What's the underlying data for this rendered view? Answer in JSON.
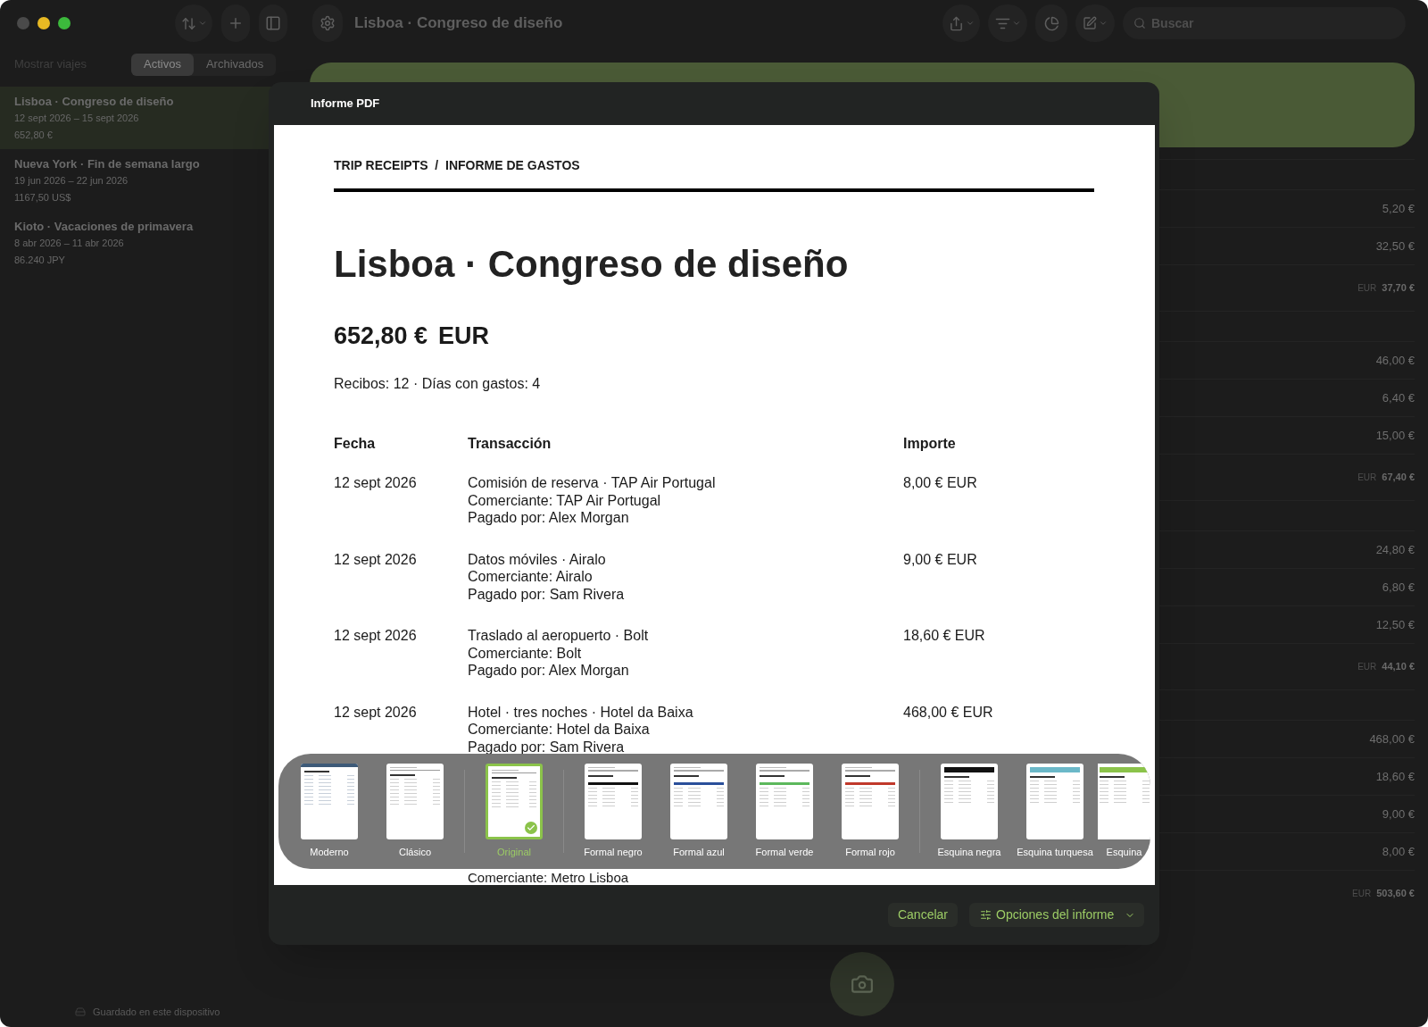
{
  "window": {
    "title": "Lisboa · Congreso de diseño"
  },
  "toolbar": {
    "search": {
      "placeholder": "Buscar"
    }
  },
  "sidebar": {
    "filter_label": "Mostrar viajes",
    "segments": [
      {
        "label": "Activos",
        "selected": true
      },
      {
        "label": "Archivados",
        "selected": false
      }
    ],
    "trips": [
      {
        "title": "Lisboa · Congreso de diseño",
        "dates": "12 sept 2026 – 15 sept 2026",
        "total": "652,80 €",
        "selected": true
      },
      {
        "title": "Nueva York · Fin de semana largo",
        "dates": "19 jun 2026 – 22 jun 2026",
        "total": "1167,50 US$",
        "selected": false
      },
      {
        "title": "Kioto · Vacaciones de primavera",
        "dates": "8 abr 2026 – 11 abr 2026",
        "total": "86.240 JPY",
        "selected": false
      }
    ],
    "status": "Guardado en este dispositivo"
  },
  "expense_groups": [
    {
      "amounts": [
        "5,20 €",
        "32,50 €"
      ],
      "subtotal": {
        "currency": "EUR",
        "amount": "37,70 €"
      }
    },
    {
      "amounts": [
        "46,00 €",
        "6,40 €",
        "15,00 €"
      ],
      "subtotal": {
        "currency": "EUR",
        "amount": "67,40 €"
      }
    },
    {
      "amounts": [
        "24,80 €",
        "6,80 €",
        "12,50 €"
      ],
      "subtotal": {
        "currency": "EUR",
        "amount": "44,10 €"
      }
    },
    {
      "amounts": [
        "468,00 €",
        "18,60 €",
        "9,00 €",
        "8,00 €"
      ],
      "subtotal": {
        "currency": "EUR",
        "amount": "503,60 €"
      }
    }
  ],
  "dialog": {
    "title": "Informe PDF",
    "report": {
      "header": "TRIP RECEIPTS  /  INFORME DE GASTOS",
      "title": "Lisboa · Congreso de diseño",
      "total_amount": "652,80 €",
      "total_currency": "EUR",
      "summary": "Recibos: 12 · Días con gastos: 4",
      "columns": [
        "Fecha",
        "Transacción",
        "Importe"
      ],
      "rows": [
        {
          "date": "12 sept 2026",
          "description": "Comisión de reserva · TAP Air Portugal",
          "merchant": "Comerciante: TAP Air Portugal",
          "paid_by": "Pagado por: Alex Morgan",
          "amount": "8,00 € EUR"
        },
        {
          "date": "12 sept 2026",
          "description": "Datos móviles · Airalo",
          "merchant": "Comerciante: Airalo",
          "paid_by": "Pagado por: Sam Rivera",
          "amount": "9,00 € EUR"
        },
        {
          "date": "12 sept 2026",
          "description": "Traslado al aeropuerto · Bolt",
          "merchant": "Comerciante: Bolt",
          "paid_by": "Pagado por: Alex Morgan",
          "amount": "18,60 € EUR"
        },
        {
          "date": "12 sept 2026",
          "description": "Hotel · tres noches · Hotel da Baixa",
          "merchant": "Comerciante: Hotel da Baixa",
          "paid_by": "Pagado por: Sam Rivera",
          "amount": "468,00 € EUR"
        }
      ],
      "cut_line": "Comerciante: Metro Lisboa"
    },
    "templates": [
      {
        "label": "Moderno",
        "kind": "modern",
        "color": "#3d5a78",
        "selected": false,
        "divider_before": false
      },
      {
        "label": "Clásico",
        "kind": "classic",
        "color": "#9a9a9a",
        "selected": false,
        "divider_before": false
      },
      {
        "label": "Original",
        "kind": "classic",
        "color": "#9a9a9a",
        "selected": true,
        "divider_before": true
      },
      {
        "label": "Formal negro",
        "kind": "formal",
        "color": "#111111",
        "selected": false,
        "divider_before": true
      },
      {
        "label": "Formal azul",
        "kind": "formal",
        "color": "#2a4f9a",
        "selected": false,
        "divider_before": false
      },
      {
        "label": "Formal verde",
        "kind": "formal",
        "color": "#5cb85c",
        "selected": false,
        "divider_before": false
      },
      {
        "label": "Formal rojo",
        "kind": "formal",
        "color": "#c0392b",
        "selected": false,
        "divider_before": false
      },
      {
        "label": "Esquina negra",
        "kind": "corner",
        "color": "#111111",
        "selected": false,
        "divider_before": true
      },
      {
        "label": "Esquina turquesa",
        "kind": "corner",
        "color": "#6bb8c8",
        "selected": false,
        "divider_before": false
      },
      {
        "label": "Esquina",
        "kind": "corner",
        "color": "#8bc34a",
        "selected": false,
        "divider_before": false
      }
    ],
    "buttons": {
      "cancel": "Cancelar",
      "options": "Opciones del informe"
    }
  }
}
